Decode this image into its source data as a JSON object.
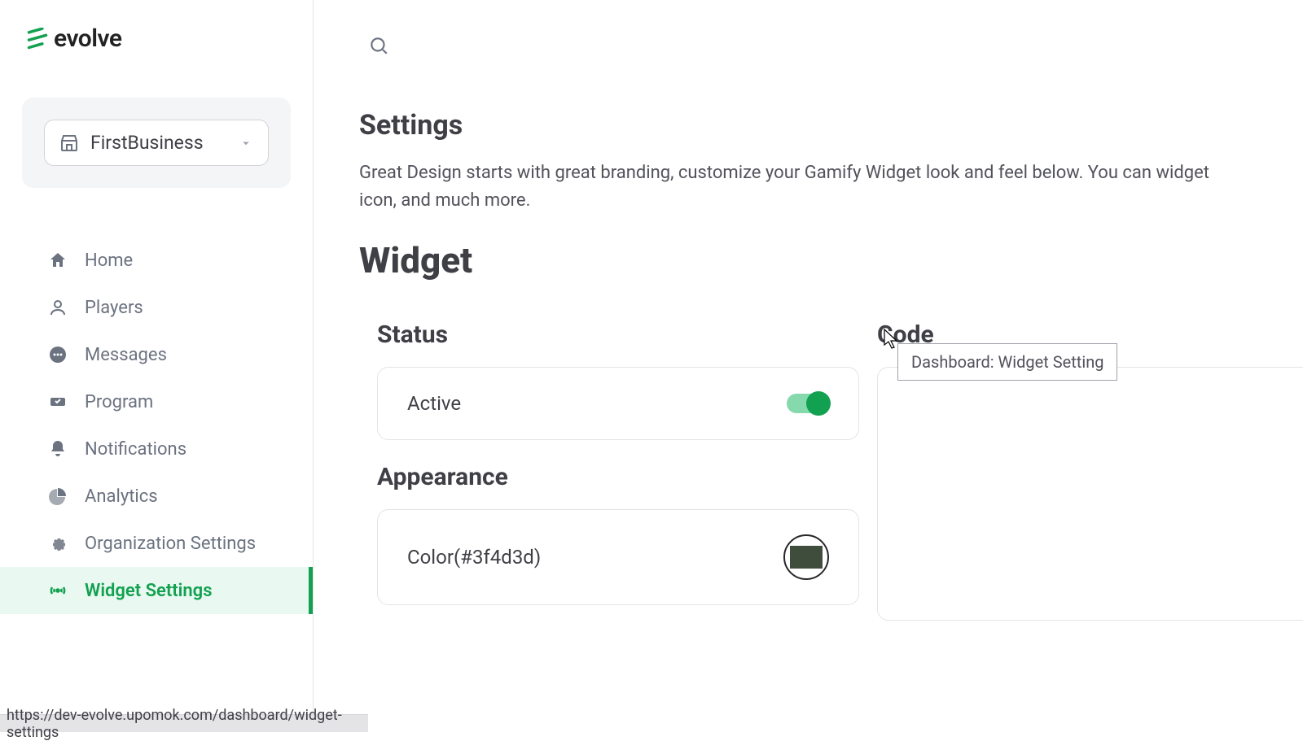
{
  "brand": {
    "name": "evolve"
  },
  "business_selector": {
    "name": "FirstBusiness"
  },
  "sidebar": {
    "items": [
      {
        "label": "Home"
      },
      {
        "label": "Players"
      },
      {
        "label": "Messages"
      },
      {
        "label": "Program"
      },
      {
        "label": "Notifications"
      },
      {
        "label": "Analytics"
      },
      {
        "label": "Organization Settings"
      },
      {
        "label": "Widget Settings"
      }
    ]
  },
  "header": {
    "title": "Settings",
    "description": "Great Design starts with great branding, customize your Gamify Widget look and feel below. You can widget icon, and much more."
  },
  "section": {
    "title": "Widget"
  },
  "status": {
    "heading": "Status",
    "active_label": "Active",
    "active_value": true
  },
  "appearance": {
    "heading": "Appearance",
    "color_label": "Color(#3f4d3d)",
    "color_value": "#3f4d3d"
  },
  "code": {
    "heading": "Code"
  },
  "tooltip": {
    "text": "Dashboard: Widget Setting"
  },
  "status_bar": {
    "url": "https://dev-evolve.upomok.com/dashboard/widget-settings"
  },
  "colors": {
    "accent": "#12a150"
  }
}
